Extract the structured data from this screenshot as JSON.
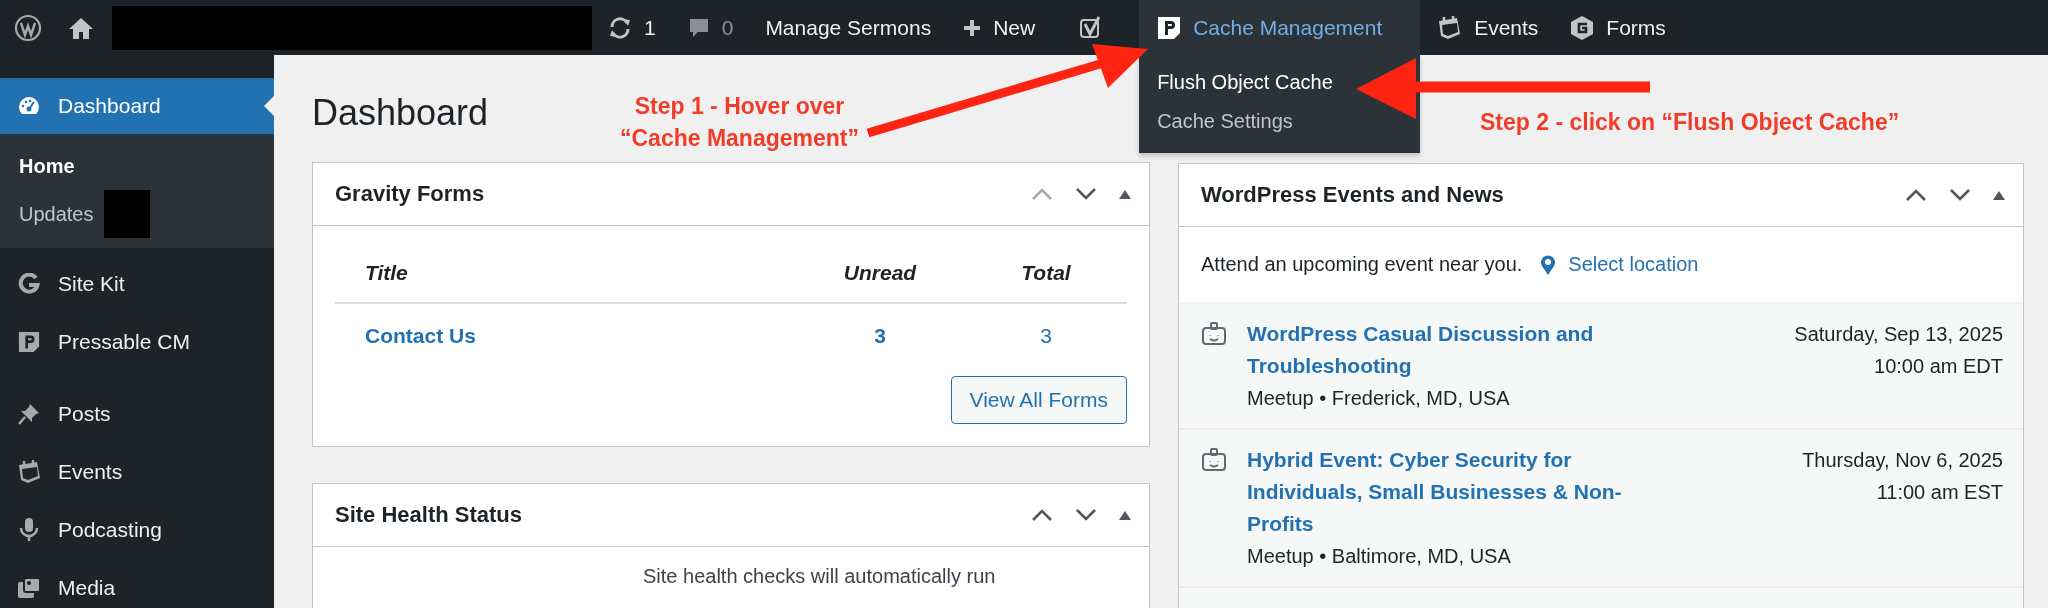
{
  "admin_bar": {
    "items": [
      {
        "kind": "wp-logo"
      },
      {
        "kind": "home"
      },
      {
        "kind": "redacted"
      },
      {
        "kind": "updates",
        "label": "1"
      },
      {
        "kind": "comments",
        "label": "0"
      },
      {
        "kind": "text",
        "label": "Manage Sermons"
      },
      {
        "kind": "new",
        "label": "New"
      },
      {
        "kind": "seo"
      },
      {
        "kind": "cache",
        "label": "Cache Management",
        "expanded": true,
        "menu": [
          {
            "label": "Flush Object Cache",
            "selected": true
          },
          {
            "label": "Cache Settings",
            "selected": false
          }
        ]
      },
      {
        "kind": "events",
        "label": "Events"
      },
      {
        "kind": "forms",
        "label": "Forms"
      }
    ]
  },
  "sidebar": {
    "items": [
      {
        "kind": "dashboard",
        "label": "Dashboard",
        "selected": true,
        "children": [
          {
            "label": "Home",
            "selected": true,
            "redacted_badge": false
          },
          {
            "label": "Updates",
            "selected": false,
            "redacted_badge": true
          }
        ]
      },
      {
        "kind": "sitekit",
        "label": "Site Kit",
        "selected": false
      },
      {
        "kind": "pressable",
        "label": "Pressable CM",
        "selected": false
      },
      {
        "kind": "separator"
      },
      {
        "kind": "posts",
        "label": "Posts",
        "selected": false
      },
      {
        "kind": "events",
        "label": "Events",
        "selected": false
      },
      {
        "kind": "podcasting",
        "label": "Podcasting",
        "selected": false
      },
      {
        "kind": "media",
        "label": "Media",
        "selected": false
      }
    ]
  },
  "page_title": "Dashboard",
  "gravity_forms": {
    "title": "Gravity Forms",
    "columns": [
      "Title",
      "Unread",
      "Total"
    ],
    "rows": [
      {
        "title": "Contact Us",
        "unread": "3",
        "total": "3"
      }
    ],
    "button": "View All Forms"
  },
  "site_health": {
    "title": "Site Health Status",
    "text": "Site health checks will automatically run"
  },
  "events_news": {
    "title": "WordPress Events and News",
    "intro": "Attend an upcoming event near you.",
    "location_link": "Select location",
    "events": [
      {
        "title": "WordPress Casual Discussion and Troubleshooting",
        "meta": "Meetup • Frederick, MD, USA",
        "date": "Saturday, Sep 13, 2025",
        "time": "10:00 am EDT"
      },
      {
        "title": "Hybrid Event: Cyber Security for Individuals, Small Businesses & Non-Profits",
        "meta": "Meetup • Baltimore, MD, USA",
        "date": "Thursday, Nov 6, 2025",
        "time": "11:00 am EST"
      }
    ]
  },
  "annotations": [
    {
      "kind": "step-1",
      "text": "Step 1 - Hover over\n“Cache Management”"
    },
    {
      "kind": "step-2",
      "text": "Step 2 - click on “Flush Object Cache”"
    }
  ]
}
